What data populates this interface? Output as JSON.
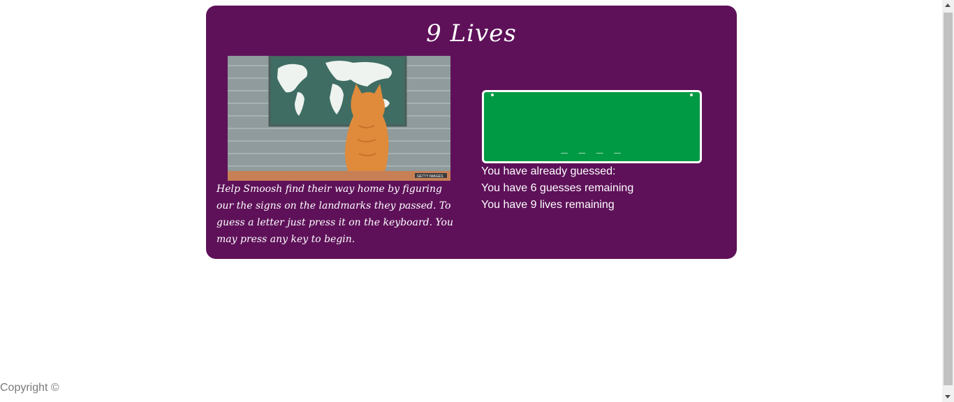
{
  "game": {
    "title": "9 Lives",
    "instructions": "Help Smoosh find their way home by figuring our the signs on the landmarks they passed. To guess a letter just press it on the keyboard. You may press any key to begin.",
    "image_caption": "GETTY IMAGES",
    "sign_word": "_ _ _ _",
    "already_guessed": "You have already guessed:",
    "guesses_remaining": "You have 6 guesses remaining",
    "lives_remaining": "You have 9 lives remaining"
  },
  "footer": {
    "copyright": "Copyright ©"
  },
  "colors": {
    "panel": "#5e1159",
    "sign": "#009a44",
    "text": "#ffffff"
  }
}
